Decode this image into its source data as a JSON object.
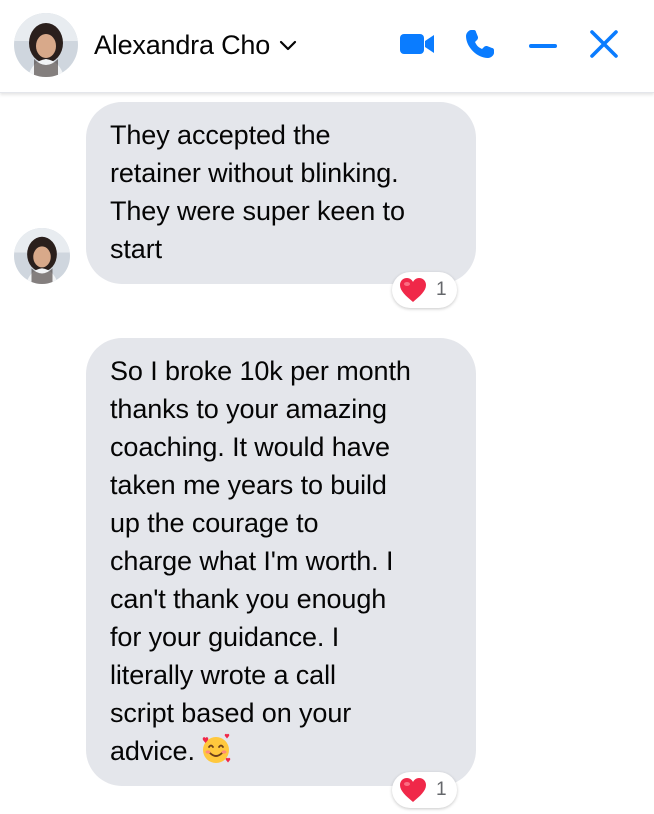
{
  "header": {
    "contact_name": "Alexandra Cho",
    "accent_color": "#0a7cff",
    "actions": [
      "video-call",
      "voice-call",
      "minimize",
      "close"
    ]
  },
  "messages": [
    {
      "lines": [
        "They accepted the",
        "retainer without blinking.",
        "They were super keen to",
        "start"
      ],
      "reaction": {
        "icon": "red-heart",
        "count": "1"
      }
    },
    {
      "lines": [
        "So I broke 10k per month",
        "thanks to your amazing",
        "coaching. It would have",
        "taken me years to build",
        "up the courage to",
        "charge what I'm worth. I",
        "can't thank you enough",
        "for your guidance. I",
        "literally wrote a call",
        "script based on your",
        "advice."
      ],
      "emoji": "smiling-face-with-hearts",
      "reaction": {
        "icon": "red-heart",
        "count": "1"
      }
    }
  ],
  "colors": {
    "bubble": "#e4e6eb",
    "text": "#050505",
    "reaction_heart": "#f02849",
    "reaction_count": "#65676b"
  }
}
